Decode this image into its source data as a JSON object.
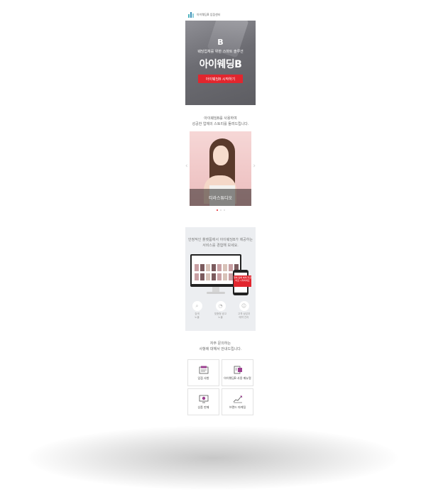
{
  "header": {
    "brand": "아이웨딩B 입점센터"
  },
  "hero": {
    "mark": "B",
    "tagline": "웨딩업체를 위한 스마트 솔루션",
    "title": "아이웨딩B",
    "cta": "아이웨딩B 시작하기"
  },
  "intro": {
    "line1": "아이웨딩B를 사용하여",
    "line2": "성공한 업체의 스토리를 들려드립니다."
  },
  "slider": {
    "caption": "티라스튜디오",
    "prev": "‹",
    "next": "›",
    "dots": 3,
    "active_index": 0
  },
  "platform": {
    "line1": "안정적인 플랫폼에서 아이웨딩B가 제공하는",
    "line2": "서비스를 경험해 보세요.",
    "banner": "업체 등록 혜택 지금 바로 시작하세요",
    "features": [
      {
        "icon": "search-icon",
        "line1": "검색",
        "line2": "노출"
      },
      {
        "icon": "chart-icon",
        "line1": "맞춤형 광고",
        "line2": "노출"
      },
      {
        "icon": "people-icon",
        "line1": "고객 상담과",
        "line2": "예약 관리"
      }
    ]
  },
  "faq": {
    "line1": "자주 문의하는",
    "line2": "사항에 대해서 안내드립니다.",
    "cards": [
      {
        "label": "입점 사항",
        "icon": "document-icon"
      },
      {
        "label": "아이웨딩B 사용 매뉴얼",
        "icon": "manual-icon"
      },
      {
        "label": "상품 판매",
        "icon": "monitor-icon"
      },
      {
        "label": "브랜드 마케팅",
        "icon": "growth-chart-icon"
      }
    ]
  },
  "colors": {
    "accent": "#e2262e",
    "brand_teal": "#4fb3bf",
    "panel_bg": "#eceef1"
  }
}
